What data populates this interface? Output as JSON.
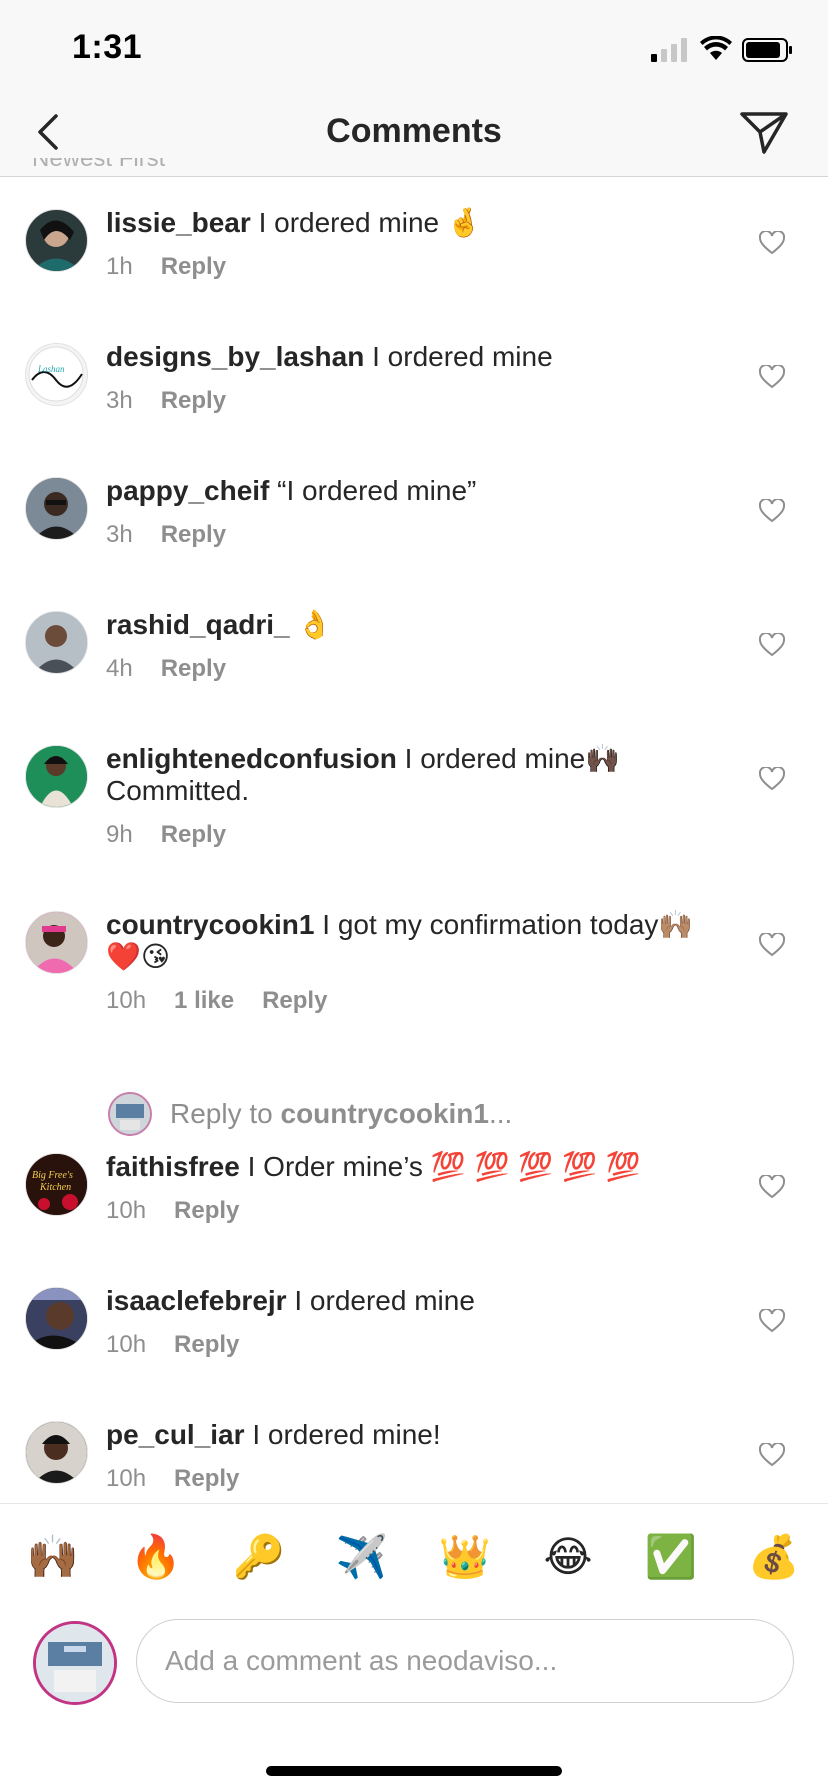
{
  "status": {
    "time": "1:31"
  },
  "header": {
    "title": "Comments",
    "sort_label": "Newest First"
  },
  "colors": {
    "accent": "#262626",
    "muted": "#8e8e8e",
    "story_ring": "#c13584"
  },
  "comments": [
    {
      "username": "lissie_bear",
      "text": "I ordered mine",
      "emoji": "🤞",
      "time": "1h",
      "likes": "",
      "reply": "Reply",
      "avatar_color": "#2b3a3a"
    },
    {
      "username": "designs_by_lashan",
      "text": "I ordered mine",
      "emoji": "",
      "time": "3h",
      "likes": "",
      "reply": "Reply",
      "avatar_color": "#f4f4f4"
    },
    {
      "username": "pappy_cheif",
      "text": "“I ordered mine”",
      "emoji": "",
      "time": "3h",
      "likes": "",
      "reply": "Reply",
      "avatar_color": "#5a6a78"
    },
    {
      "username": "rashid_qadri_",
      "text": "",
      "emoji": "👌",
      "time": "4h",
      "likes": "",
      "reply": "Reply",
      "avatar_color": "#9aa3ad"
    },
    {
      "username": "enlightenedconfusion",
      "text": "I ordered mine",
      "emoji": "🙌🏿",
      "line2": "Committed.",
      "time": "9h",
      "likes": "",
      "reply": "Reply",
      "avatar_color": "#1f8f5a"
    },
    {
      "username": "countrycookin1",
      "text": "I got my confirmation today",
      "emoji": "🙌🏽",
      "line2": "❤️😘",
      "time": "10h",
      "likes": "1 like",
      "reply": "Reply",
      "avatar_color": "#e23a8e"
    },
    {
      "username": "faithisfree",
      "text": "I Order mine’s",
      "emoji": "💯 💯 💯 💯 💯",
      "time": "10h",
      "likes": "",
      "reply": "Reply",
      "avatar_color": "#3a1a12"
    },
    {
      "username": "isaaclefebrejr",
      "text": "I ordered mine",
      "emoji": "",
      "time": "10h",
      "likes": "",
      "reply": "Reply",
      "avatar_color": "#1d2030"
    },
    {
      "username": "pe_cul_iar",
      "text": "I ordered mine!",
      "emoji": "",
      "time": "10h",
      "likes": "",
      "reply": "Reply",
      "avatar_color": "#222"
    }
  ],
  "reply_to": {
    "prefix": "Reply to",
    "username": "countrycookin1",
    "suffix": "..."
  },
  "quick_emojis": [
    "🙌🏾",
    "🔥",
    "🔑",
    "✈️",
    "👑",
    "😂",
    "✅",
    "💰"
  ],
  "comment_input": {
    "placeholder": "Add a comment as neodaviso..."
  }
}
